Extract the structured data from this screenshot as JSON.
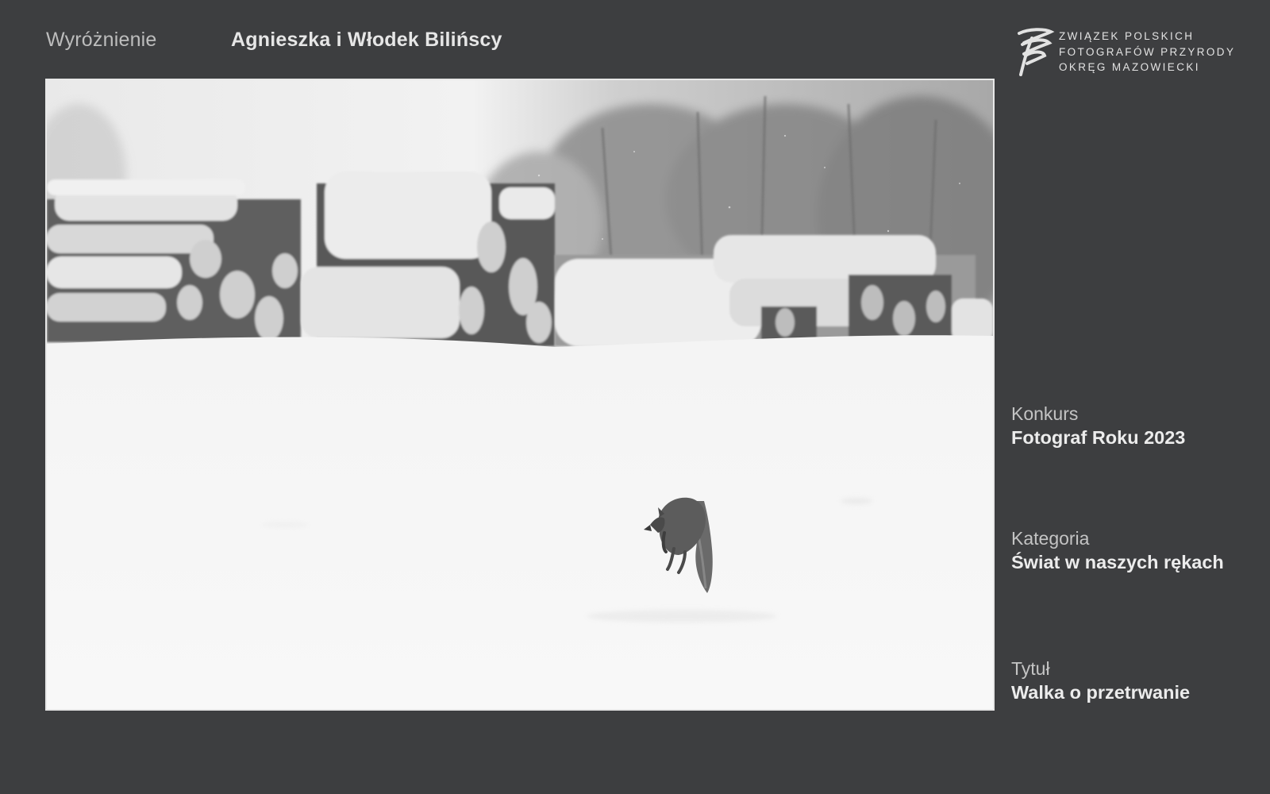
{
  "header": {
    "award": "Wyróżnienie",
    "author": "Agnieszka i Włodek Bilińscy"
  },
  "logo": {
    "icon": "zpfp-logo-icon",
    "lines": [
      "ZWIĄZEK POLSKICH",
      "FOTOGRAFÓW PRZYRODY",
      "OKRĘG MAZOWIECKI"
    ]
  },
  "photo": {
    "subject": "fox-jumping-in-snow-photo"
  },
  "details": {
    "contest": {
      "label": "Konkurs",
      "value": "Fotograf Roku 2023"
    },
    "category": {
      "label": "Kategoria",
      "value": "Świat w naszych rękach"
    },
    "title": {
      "label": "Tytuł",
      "value": "Walka o przetrwanie"
    }
  },
  "colors": {
    "background": "#3d3e40",
    "frame": "#e8e8e8",
    "text_primary": "#ececec",
    "text_secondary": "#c4c4c4"
  }
}
